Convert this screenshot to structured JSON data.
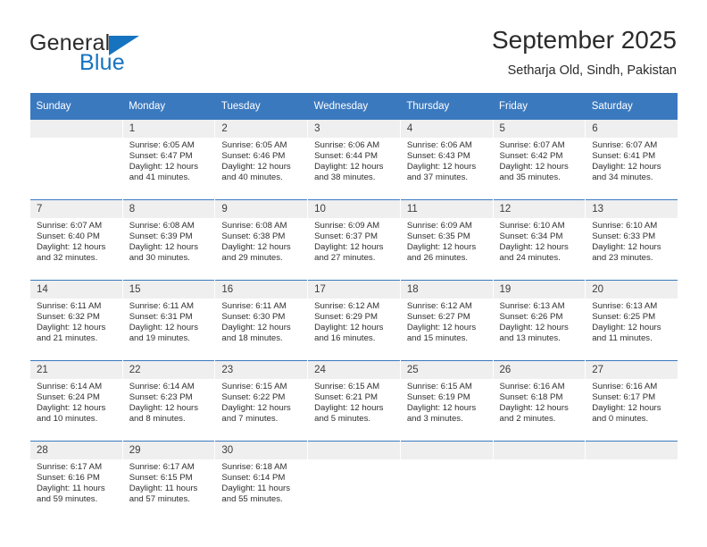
{
  "brand": {
    "name_part1": "General",
    "name_part2": "Blue",
    "triangle_color": "#1673bf",
    "logo_icon": "triangle-logo-icon"
  },
  "header": {
    "title": "September 2025",
    "subtitle": "Setharja Old, Sindh, Pakistan",
    "header_bg_color": "#3b79bf",
    "daynum_bg_color": "#efefef"
  },
  "weekday_headers": [
    "Sunday",
    "Monday",
    "Tuesday",
    "Wednesday",
    "Thursday",
    "Friday",
    "Saturday"
  ],
  "weeks": [
    [
      {
        "day": "",
        "sunrise": "",
        "sunset": "",
        "daylight_line1": "",
        "daylight_line2": ""
      },
      {
        "day": "1",
        "sunrise": "Sunrise: 6:05 AM",
        "sunset": "Sunset: 6:47 PM",
        "daylight_line1": "Daylight: 12 hours",
        "daylight_line2": "and 41 minutes."
      },
      {
        "day": "2",
        "sunrise": "Sunrise: 6:05 AM",
        "sunset": "Sunset: 6:46 PM",
        "daylight_line1": "Daylight: 12 hours",
        "daylight_line2": "and 40 minutes."
      },
      {
        "day": "3",
        "sunrise": "Sunrise: 6:06 AM",
        "sunset": "Sunset: 6:44 PM",
        "daylight_line1": "Daylight: 12 hours",
        "daylight_line2": "and 38 minutes."
      },
      {
        "day": "4",
        "sunrise": "Sunrise: 6:06 AM",
        "sunset": "Sunset: 6:43 PM",
        "daylight_line1": "Daylight: 12 hours",
        "daylight_line2": "and 37 minutes."
      },
      {
        "day": "5",
        "sunrise": "Sunrise: 6:07 AM",
        "sunset": "Sunset: 6:42 PM",
        "daylight_line1": "Daylight: 12 hours",
        "daylight_line2": "and 35 minutes."
      },
      {
        "day": "6",
        "sunrise": "Sunrise: 6:07 AM",
        "sunset": "Sunset: 6:41 PM",
        "daylight_line1": "Daylight: 12 hours",
        "daylight_line2": "and 34 minutes."
      }
    ],
    [
      {
        "day": "7",
        "sunrise": "Sunrise: 6:07 AM",
        "sunset": "Sunset: 6:40 PM",
        "daylight_line1": "Daylight: 12 hours",
        "daylight_line2": "and 32 minutes."
      },
      {
        "day": "8",
        "sunrise": "Sunrise: 6:08 AM",
        "sunset": "Sunset: 6:39 PM",
        "daylight_line1": "Daylight: 12 hours",
        "daylight_line2": "and 30 minutes."
      },
      {
        "day": "9",
        "sunrise": "Sunrise: 6:08 AM",
        "sunset": "Sunset: 6:38 PM",
        "daylight_line1": "Daylight: 12 hours",
        "daylight_line2": "and 29 minutes."
      },
      {
        "day": "10",
        "sunrise": "Sunrise: 6:09 AM",
        "sunset": "Sunset: 6:37 PM",
        "daylight_line1": "Daylight: 12 hours",
        "daylight_line2": "and 27 minutes."
      },
      {
        "day": "11",
        "sunrise": "Sunrise: 6:09 AM",
        "sunset": "Sunset: 6:35 PM",
        "daylight_line1": "Daylight: 12 hours",
        "daylight_line2": "and 26 minutes."
      },
      {
        "day": "12",
        "sunrise": "Sunrise: 6:10 AM",
        "sunset": "Sunset: 6:34 PM",
        "daylight_line1": "Daylight: 12 hours",
        "daylight_line2": "and 24 minutes."
      },
      {
        "day": "13",
        "sunrise": "Sunrise: 6:10 AM",
        "sunset": "Sunset: 6:33 PM",
        "daylight_line1": "Daylight: 12 hours",
        "daylight_line2": "and 23 minutes."
      }
    ],
    [
      {
        "day": "14",
        "sunrise": "Sunrise: 6:11 AM",
        "sunset": "Sunset: 6:32 PM",
        "daylight_line1": "Daylight: 12 hours",
        "daylight_line2": "and 21 minutes."
      },
      {
        "day": "15",
        "sunrise": "Sunrise: 6:11 AM",
        "sunset": "Sunset: 6:31 PM",
        "daylight_line1": "Daylight: 12 hours",
        "daylight_line2": "and 19 minutes."
      },
      {
        "day": "16",
        "sunrise": "Sunrise: 6:11 AM",
        "sunset": "Sunset: 6:30 PM",
        "daylight_line1": "Daylight: 12 hours",
        "daylight_line2": "and 18 minutes."
      },
      {
        "day": "17",
        "sunrise": "Sunrise: 6:12 AM",
        "sunset": "Sunset: 6:29 PM",
        "daylight_line1": "Daylight: 12 hours",
        "daylight_line2": "and 16 minutes."
      },
      {
        "day": "18",
        "sunrise": "Sunrise: 6:12 AM",
        "sunset": "Sunset: 6:27 PM",
        "daylight_line1": "Daylight: 12 hours",
        "daylight_line2": "and 15 minutes."
      },
      {
        "day": "19",
        "sunrise": "Sunrise: 6:13 AM",
        "sunset": "Sunset: 6:26 PM",
        "daylight_line1": "Daylight: 12 hours",
        "daylight_line2": "and 13 minutes."
      },
      {
        "day": "20",
        "sunrise": "Sunrise: 6:13 AM",
        "sunset": "Sunset: 6:25 PM",
        "daylight_line1": "Daylight: 12 hours",
        "daylight_line2": "and 11 minutes."
      }
    ],
    [
      {
        "day": "21",
        "sunrise": "Sunrise: 6:14 AM",
        "sunset": "Sunset: 6:24 PM",
        "daylight_line1": "Daylight: 12 hours",
        "daylight_line2": "and 10 minutes."
      },
      {
        "day": "22",
        "sunrise": "Sunrise: 6:14 AM",
        "sunset": "Sunset: 6:23 PM",
        "daylight_line1": "Daylight: 12 hours",
        "daylight_line2": "and 8 minutes."
      },
      {
        "day": "23",
        "sunrise": "Sunrise: 6:15 AM",
        "sunset": "Sunset: 6:22 PM",
        "daylight_line1": "Daylight: 12 hours",
        "daylight_line2": "and 7 minutes."
      },
      {
        "day": "24",
        "sunrise": "Sunrise: 6:15 AM",
        "sunset": "Sunset: 6:21 PM",
        "daylight_line1": "Daylight: 12 hours",
        "daylight_line2": "and 5 minutes."
      },
      {
        "day": "25",
        "sunrise": "Sunrise: 6:15 AM",
        "sunset": "Sunset: 6:19 PM",
        "daylight_line1": "Daylight: 12 hours",
        "daylight_line2": "and 3 minutes."
      },
      {
        "day": "26",
        "sunrise": "Sunrise: 6:16 AM",
        "sunset": "Sunset: 6:18 PM",
        "daylight_line1": "Daylight: 12 hours",
        "daylight_line2": "and 2 minutes."
      },
      {
        "day": "27",
        "sunrise": "Sunrise: 6:16 AM",
        "sunset": "Sunset: 6:17 PM",
        "daylight_line1": "Daylight: 12 hours",
        "daylight_line2": "and 0 minutes."
      }
    ],
    [
      {
        "day": "28",
        "sunrise": "Sunrise: 6:17 AM",
        "sunset": "Sunset: 6:16 PM",
        "daylight_line1": "Daylight: 11 hours",
        "daylight_line2": "and 59 minutes."
      },
      {
        "day": "29",
        "sunrise": "Sunrise: 6:17 AM",
        "sunset": "Sunset: 6:15 PM",
        "daylight_line1": "Daylight: 11 hours",
        "daylight_line2": "and 57 minutes."
      },
      {
        "day": "30",
        "sunrise": "Sunrise: 6:18 AM",
        "sunset": "Sunset: 6:14 PM",
        "daylight_line1": "Daylight: 11 hours",
        "daylight_line2": "and 55 minutes."
      },
      {
        "day": "",
        "sunrise": "",
        "sunset": "",
        "daylight_line1": "",
        "daylight_line2": ""
      },
      {
        "day": "",
        "sunrise": "",
        "sunset": "",
        "daylight_line1": "",
        "daylight_line2": ""
      },
      {
        "day": "",
        "sunrise": "",
        "sunset": "",
        "daylight_line1": "",
        "daylight_line2": ""
      },
      {
        "day": "",
        "sunrise": "",
        "sunset": "",
        "daylight_line1": "",
        "daylight_line2": ""
      }
    ]
  ]
}
